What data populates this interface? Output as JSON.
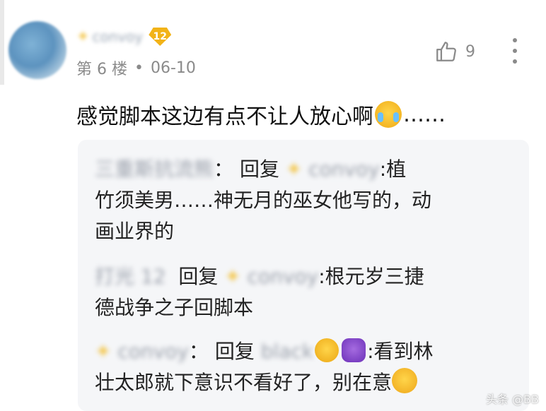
{
  "comment": {
    "author_name": "convoy",
    "level": "12",
    "floor": "第 6 楼",
    "separator": "•",
    "date": "06-10",
    "likes": "9",
    "text": "感觉脚本这边有点不让人放心啊",
    "text_suffix": "……"
  },
  "replies": [
    {
      "user": "三重斯抗流熊",
      "colon": "：",
      "action": "回复",
      "target": "convoy",
      "line1_tail": ":植",
      "lines": [
        "竹须美男……神无月的巫女他写的，动",
        "画业界的"
      ]
    },
    {
      "user": "打光 12",
      "action": "回复",
      "target": "convoy",
      "line1_tail": ":根元岁三捷",
      "lines": [
        "德战争之子回脚本"
      ]
    },
    {
      "user": "convoy",
      "colon": "：",
      "action": "回复",
      "target": "black",
      "line1_tail": ":看到林",
      "lines": [
        "壮太郎就下意识不看好了，别在意"
      ]
    }
  ],
  "watermark": "头条 @BB",
  "icons": [
    "avatar",
    "star-icon",
    "level-badge",
    "thumb-up-icon",
    "more-vertical-icon",
    "crying-emoji",
    "laughing-emoji",
    "devil-emoji",
    "grin-emoji"
  ]
}
